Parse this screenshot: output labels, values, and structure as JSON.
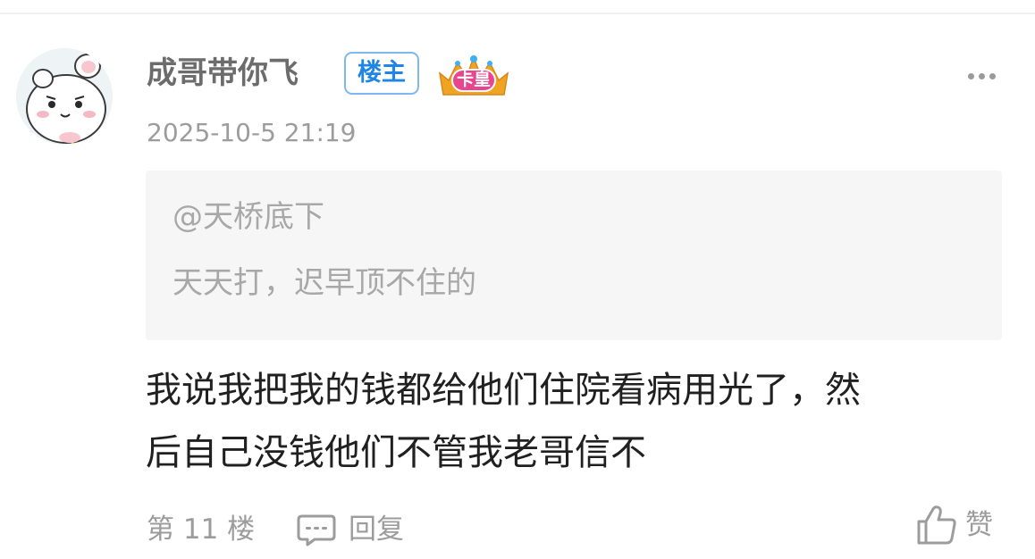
{
  "post": {
    "username": "成哥带你飞",
    "op_badge": "楼主",
    "level_badge": "卡皇",
    "timestamp": "2025-10-5 21:19",
    "quote": {
      "author": "@天桥底下",
      "text": "天天打，迟早顶不住的"
    },
    "body_lines": [
      "我说我把我的钱都给他们住院看病用光了，然",
      "后自己没钱他们不管我老哥信不"
    ],
    "footer": {
      "floor": "第 11 楼",
      "reply_label": "回复",
      "like_label": "赞"
    }
  },
  "icons": {
    "avatar": "cartoon-avatar",
    "badge": "crown-icon",
    "more": "more-dots-icon",
    "reply": "comment-icon",
    "like": "thumbs-up-icon"
  },
  "colors": {
    "op_badge_text": "#1f85e6",
    "op_badge_border": "#7fb8f0",
    "badge_crown": "#f0a522",
    "badge_pink": "#e8458e",
    "muted_text": "#9c9c9c",
    "body_text": "#202020",
    "quote_bg": "#f6f6f6"
  }
}
